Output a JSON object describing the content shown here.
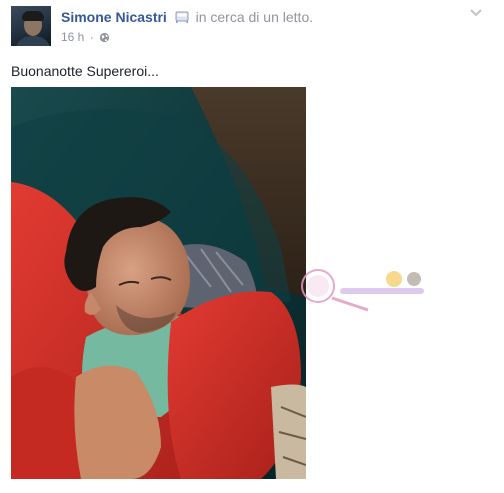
{
  "post": {
    "author": "Simone Nicastri",
    "activity": "in cerca di un letto.",
    "activity_icon": "bed-icon",
    "timestamp": "16 h",
    "separator": "·",
    "privacy_icon": "globe-icon",
    "menu_icon": "chevron-down-icon",
    "text": "Buonanotte Supereroi...",
    "photo": "sleeping-man-on-red-pillow",
    "watermark": "blog-watermark-logo"
  },
  "colors": {
    "author_link": "#365899",
    "meta_text": "#90949c",
    "body_text": "#1d2129",
    "background": "#ffffff"
  }
}
